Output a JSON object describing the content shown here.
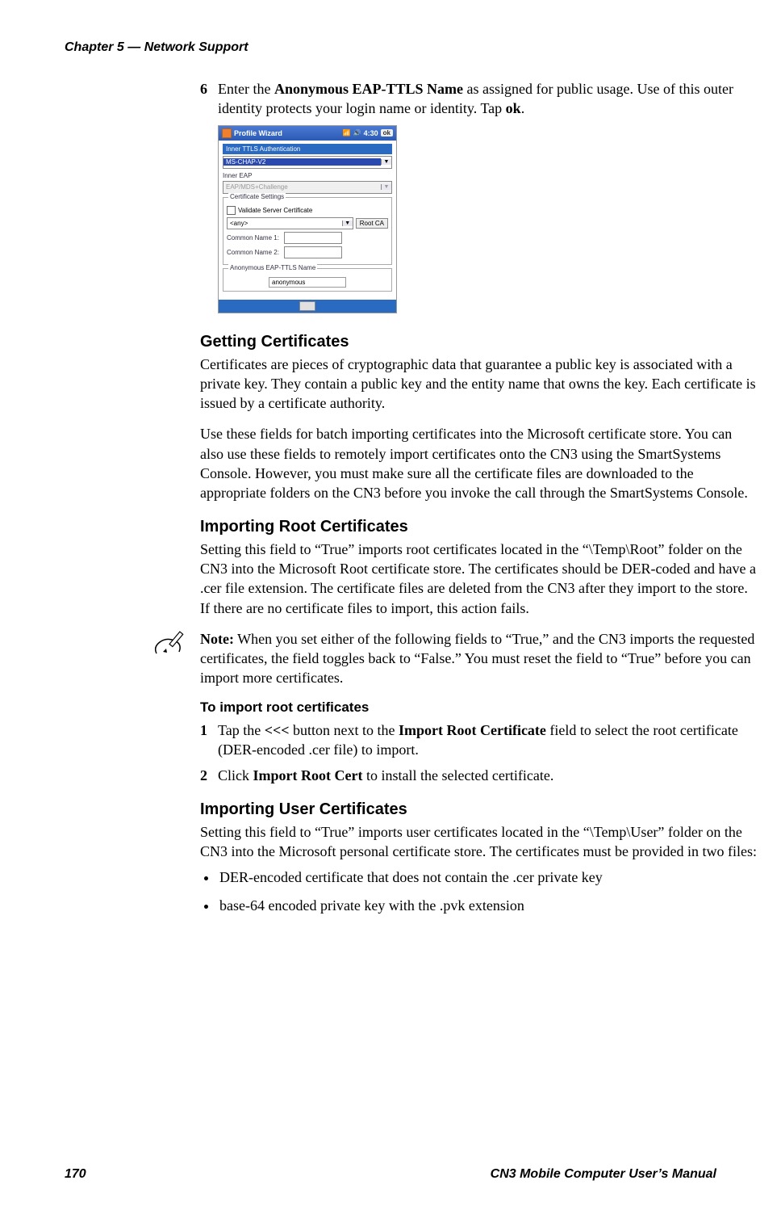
{
  "header": {
    "chapter": "Chapter 5 — Network Support"
  },
  "step6": {
    "num": "6",
    "pre": "Enter the ",
    "bold1": "Anonymous EAP-TTLS Name",
    "mid": " as assigned for public usage. Use of this outer identity protects your login name or identity. Tap ",
    "bold2": "ok",
    "post": "."
  },
  "wizard": {
    "title": "Profile Wizard",
    "time": "4:30",
    "ok": "ok",
    "inner_ttls_label": "Inner TTLS Authentication",
    "inner_ttls_value": "MS-CHAP-V2",
    "inner_eap_label": "Inner EAP",
    "inner_eap_value": "EAP/MDS+Challenge",
    "cert_legend": "Certificate Settings",
    "validate_label": "Validate Server Certificate",
    "any": "<any>",
    "rootca": "Root CA",
    "cn1": "Common Name 1:",
    "cn2": "Common Name 2:",
    "anon_legend": "Anonymous EAP-TTLS Name",
    "anon_value": "anonymous"
  },
  "sections": {
    "getting_title": "Getting Certificates",
    "getting_p1": "Certificates are pieces of cryptographic data that guarantee a public key is associated with a private key. They contain a public key and the entity name that owns the key. Each certificate is issued by a certificate authority.",
    "getting_p2": "Use these fields for batch importing certificates into the Microsoft certificate store. You can also use these fields to remotely import certificates onto the CN3 using the SmartSystems Console. However, you must make sure all the certificate files are downloaded to the appropriate folders on the CN3 before you invoke the call through the SmartSystems Console.",
    "import_root_title": "Importing Root Certificates",
    "import_root_p": "Setting this field to “True” imports root certificates located in the “\\Temp\\Root” folder on the CN3 into the Microsoft Root certificate store. The certificates should be DER-coded and have a .cer file extension. The certificate files are deleted from the CN3 after they import to the store. If there are no certificate files to import, this action fails.",
    "note_bold": "Note:",
    "note_text": " When you set either of the following fields to “True,” and the CN3 imports the requested certificates, the field toggles back to “False.” You must reset the field to “True” before you can import more certificates.",
    "to_import_title": "To import root certificates",
    "step1": {
      "num": "1",
      "pre": "Tap the ",
      "bold1": "<<<",
      "mid1": " button next to the ",
      "bold2": "Import Root Certificate",
      "mid2": " field to select the root certificate (DER-encoded .cer file) to import."
    },
    "step2": {
      "num": "2",
      "pre": "Click ",
      "bold": "Import Root Cert",
      "post": " to install the selected certificate."
    },
    "import_user_title": "Importing User Certificates",
    "import_user_p": "Setting this field to “True” imports user certificates located in the “\\Temp\\User” folder on the CN3 into the Microsoft personal certificate store. The certificates must be provided in two files:",
    "bullet1": "DER-encoded certificate that does not contain the .cer private key",
    "bullet2": "base-64 encoded private key with the .pvk extension"
  },
  "footer": {
    "page": "170",
    "manual": "CN3 Mobile Computer User’s Manual"
  }
}
